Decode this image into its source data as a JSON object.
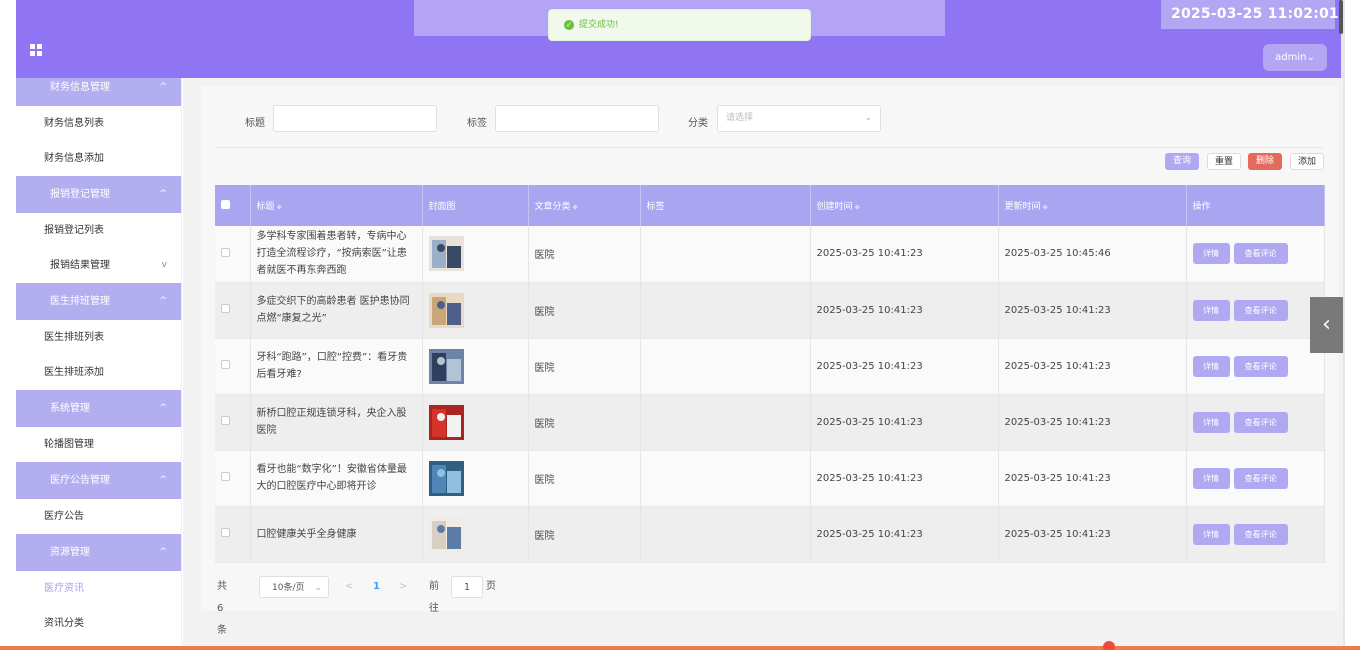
{
  "header": {
    "clock": "2025-03-25 11:02:01",
    "user_button": "admin",
    "user_chevron": "⌄"
  },
  "toast": {
    "message": "提交成功!"
  },
  "sidebar": [
    {
      "type": "group",
      "label": "财务信息管理",
      "chev": "^"
    },
    {
      "type": "item",
      "label": "财务信息列表"
    },
    {
      "type": "item",
      "label": "财务信息添加"
    },
    {
      "type": "group",
      "label": "报销登记管理",
      "chev": "^"
    },
    {
      "type": "item",
      "label": "报销登记列表"
    },
    {
      "type": "sub",
      "label": "报销结果管理",
      "chev": "v"
    },
    {
      "type": "group",
      "label": "医生排班管理",
      "chev": "^"
    },
    {
      "type": "item",
      "label": "医生排班列表"
    },
    {
      "type": "item",
      "label": "医生排班添加"
    },
    {
      "type": "group",
      "label": "系统管理",
      "chev": "^"
    },
    {
      "type": "item",
      "label": "轮播图管理"
    },
    {
      "type": "group",
      "label": "医疗公告管理",
      "chev": "^"
    },
    {
      "type": "item",
      "label": "医疗公告"
    },
    {
      "type": "group",
      "label": "资源管理",
      "chev": "^"
    },
    {
      "type": "item",
      "label": "医疗资讯",
      "active": true
    },
    {
      "type": "item",
      "label": "资讯分类"
    }
  ],
  "filters": {
    "title_label": "标题",
    "tag_label": "标签",
    "category_label": "分类",
    "category_placeholder": "请选择"
  },
  "toolbar": {
    "query": "查询",
    "reset": "重置",
    "delete": "删除",
    "add": "添加"
  },
  "table": {
    "headers": [
      "标题",
      "封面图",
      "文章分类",
      "标签",
      "创建时间",
      "更新时间",
      "操作"
    ],
    "sort_mark": "◆",
    "detail_label": "详情",
    "comment_label": "查看评论",
    "rows": [
      {
        "title": "多学科专家围着患者转，专病中心打造全流程诊疗，“按病索医”让患者就医不再东奔西跑",
        "category": "医院",
        "tag": "",
        "created": "2025-03-25 10:41:23",
        "updated": "2025-03-25 10:45:46",
        "thumb_colors": [
          "#9ab0c8",
          "#3b4a64",
          "#e8e2da"
        ]
      },
      {
        "title": "多症交织下的高龄患者 医护患协同点燃“康复之光”",
        "category": "医院",
        "tag": "",
        "created": "2025-03-25 10:41:23",
        "updated": "2025-03-25 10:41:23",
        "thumb_colors": [
          "#c9a57a",
          "#4f5f8c",
          "#e7d9c4"
        ]
      },
      {
        "title": "牙科“跑路”，口腔“控费”：看牙贵后看牙难?",
        "category": "医院",
        "tag": "",
        "created": "2025-03-25 10:41:23",
        "updated": "2025-03-25 10:41:23",
        "thumb_colors": [
          "#2f3f5c",
          "#b3c3d6",
          "#6c84a8"
        ]
      },
      {
        "title": "新桥口腔正规连锁牙科，央企入股医院",
        "category": "医院",
        "tag": "",
        "created": "2025-03-25 10:41:23",
        "updated": "2025-03-25 10:41:23",
        "thumb_colors": [
          "#d5332b",
          "#f2f2f2",
          "#a82520"
        ]
      },
      {
        "title": "看牙也能“数字化”！安徽省体量最大的口腔医疗中心即将开诊",
        "category": "医院",
        "tag": "",
        "created": "2025-03-25 10:41:23",
        "updated": "2025-03-25 10:41:23",
        "thumb_colors": [
          "#4f86b6",
          "#8fc0df",
          "#2f5f82"
        ]
      },
      {
        "title": "口腔健康关乎全身健康",
        "category": "医院",
        "tag": "",
        "created": "2025-03-25 10:41:23",
        "updated": "2025-03-25 10:41:23",
        "thumb_colors": [
          "#d8cfc2",
          "#5c7ca8",
          "#f0ebe4"
        ]
      }
    ]
  },
  "pagination": {
    "total": "共 6 条",
    "page_size": "10条/页",
    "prev": "<",
    "current": "1",
    "next": ">",
    "goto_prefix": "前往",
    "goto_value": "1",
    "goto_suffix": "页"
  },
  "side_tab": {
    "glyph": "‹"
  },
  "colors": {
    "header": "#8f74f4",
    "accent": "#aaa5f1",
    "danger": "#e46a5d"
  }
}
